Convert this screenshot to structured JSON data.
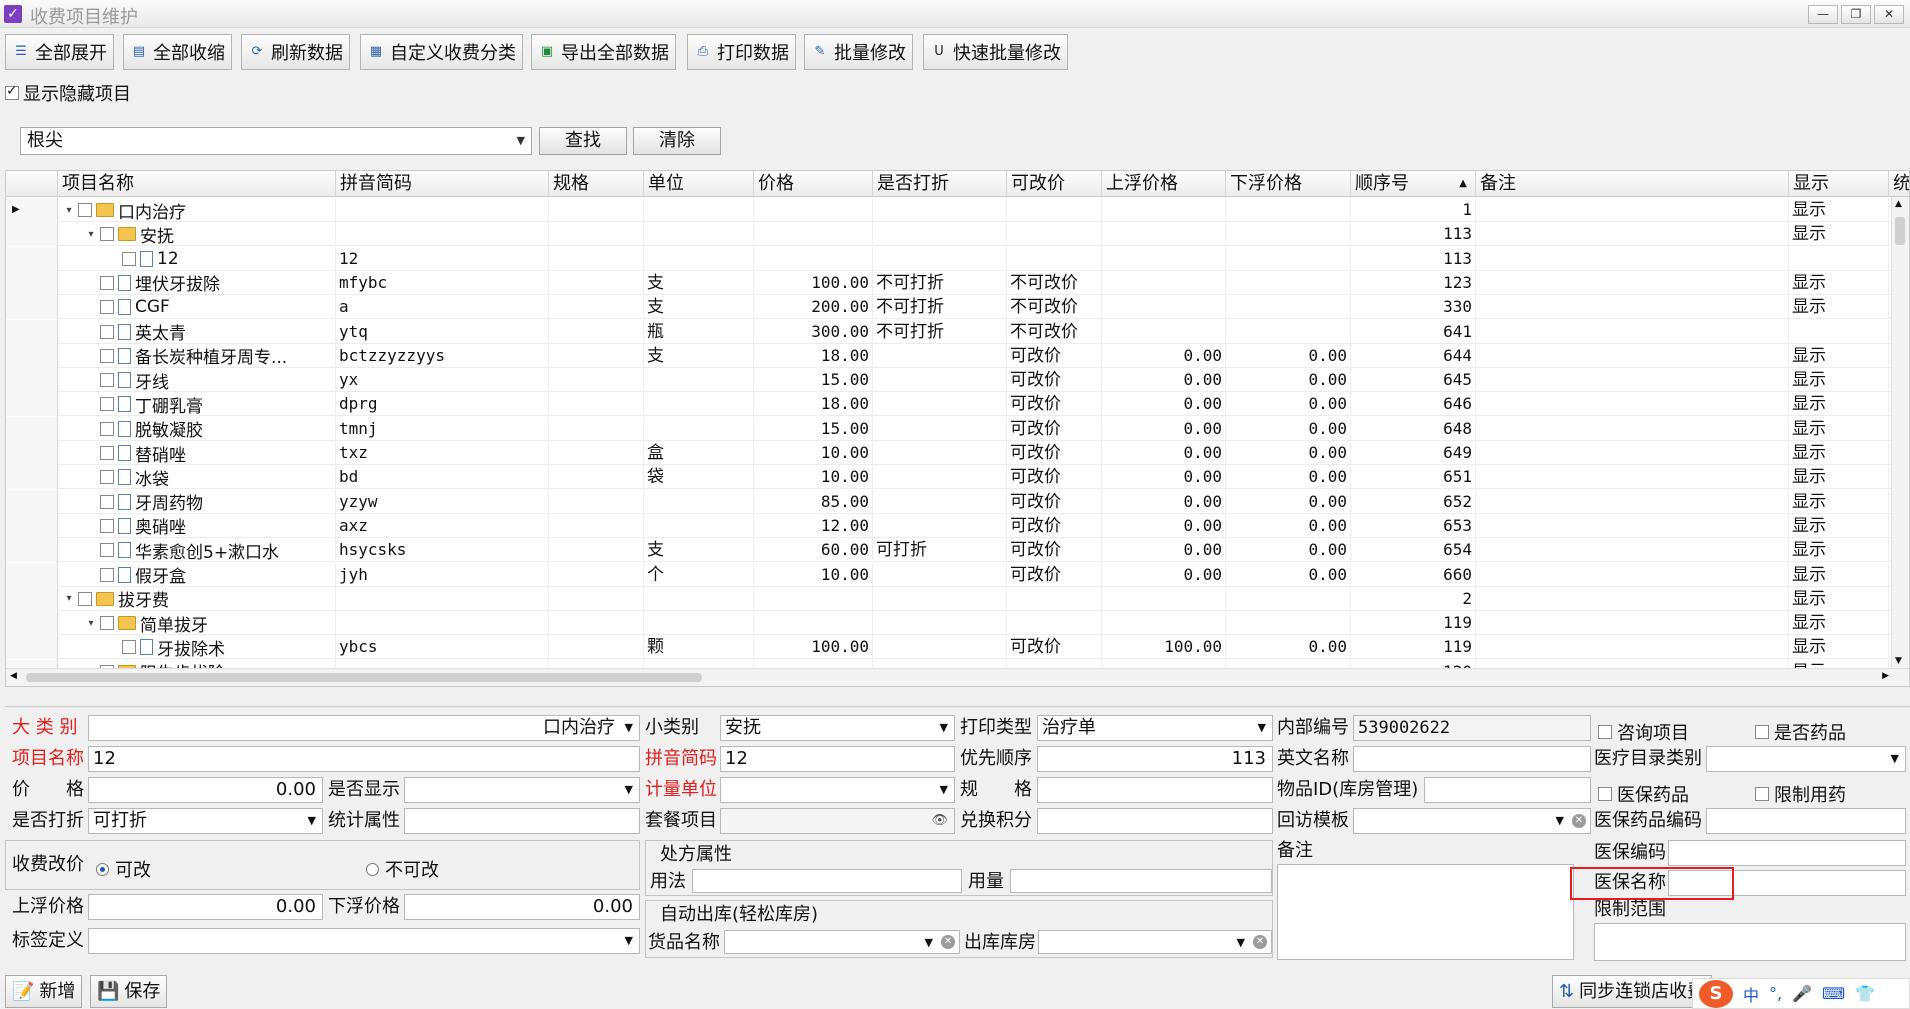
{
  "window": {
    "title": "收费项目维护",
    "controls": [
      "—",
      "❐",
      "✕"
    ]
  },
  "toolbar": {
    "expand_all": "全部展开",
    "collapse_all": "全部收缩",
    "refresh": "刷新数据",
    "custom_category": "自定义收费分类",
    "export_all": "导出全部数据",
    "print": "打印数据",
    "batch_edit": "批量修改",
    "quick_batch_edit": "快速批量修改"
  },
  "show_hidden": {
    "label": "显示隐藏项目",
    "checked": true
  },
  "search": {
    "value": "根尖",
    "find_label": "查找",
    "clear_label": "清除"
  },
  "grid": {
    "columns": [
      "项目名称",
      "拼音简码",
      "规格",
      "单位",
      "价格",
      "是否打折",
      "可改价",
      "上浮价格",
      "下浮价格",
      "顺序号",
      "备注",
      "显示",
      "统计"
    ],
    "sorted_column": "顺序号",
    "rows": [
      {
        "name": "口内治疗",
        "py": "",
        "unit": "",
        "price": "",
        "discount": "",
        "changeable": "",
        "up": "",
        "down": "",
        "order": "1",
        "show": "显示",
        "level": 0,
        "kind": "folder",
        "expanded": true,
        "current": true
      },
      {
        "name": "安抚",
        "py": "",
        "unit": "",
        "price": "",
        "discount": "",
        "changeable": "",
        "up": "",
        "down": "",
        "order": "113",
        "show": "显示",
        "level": 1,
        "kind": "folder",
        "expanded": true
      },
      {
        "name": "12",
        "py": "12",
        "unit": "",
        "price": "",
        "discount": "",
        "changeable": "",
        "up": "",
        "down": "",
        "order": "113",
        "show": "",
        "level": 2,
        "kind": "doc"
      },
      {
        "name": "埋伏牙拔除",
        "py": "mfybc",
        "unit": "支",
        "price": "100.00",
        "discount": "不可打折",
        "changeable": "不可改价",
        "up": "",
        "down": "",
        "order": "123",
        "show": "显示",
        "level": 1,
        "kind": "doc"
      },
      {
        "name": "CGF",
        "py": "a",
        "unit": "支",
        "price": "200.00",
        "discount": "不可打折",
        "changeable": "不可改价",
        "up": "",
        "down": "",
        "order": "330",
        "show": "显示",
        "level": 1,
        "kind": "doc"
      },
      {
        "name": "英太青",
        "py": "ytq",
        "unit": "瓶",
        "price": "300.00",
        "discount": "不可打折",
        "changeable": "不可改价",
        "up": "",
        "down": "",
        "order": "641",
        "show": "",
        "level": 1,
        "kind": "doc"
      },
      {
        "name": "备长炭种植牙周专...",
        "py": "bctzzyzzyys",
        "unit": "支",
        "price": "18.00",
        "discount": "",
        "changeable": "可改价",
        "up": "0.00",
        "down": "0.00",
        "order": "644",
        "show": "显示",
        "level": 1,
        "kind": "doc"
      },
      {
        "name": "牙线",
        "py": "yx",
        "unit": "",
        "price": "15.00",
        "discount": "",
        "changeable": "可改价",
        "up": "0.00",
        "down": "0.00",
        "order": "645",
        "show": "显示",
        "level": 1,
        "kind": "doc"
      },
      {
        "name": "丁硼乳膏",
        "py": "dprg",
        "unit": "",
        "price": "18.00",
        "discount": "",
        "changeable": "可改价",
        "up": "0.00",
        "down": "0.00",
        "order": "646",
        "show": "显示",
        "level": 1,
        "kind": "doc"
      },
      {
        "name": "脱敏凝胶",
        "py": "tmnj",
        "unit": "",
        "price": "15.00",
        "discount": "",
        "changeable": "可改价",
        "up": "0.00",
        "down": "0.00",
        "order": "648",
        "show": "显示",
        "level": 1,
        "kind": "doc"
      },
      {
        "name": "替硝唑",
        "py": "txz",
        "unit": "盒",
        "price": "10.00",
        "discount": "",
        "changeable": "可改价",
        "up": "0.00",
        "down": "0.00",
        "order": "649",
        "show": "显示",
        "level": 1,
        "kind": "doc"
      },
      {
        "name": "冰袋",
        "py": "bd",
        "unit": "袋",
        "price": "10.00",
        "discount": "",
        "changeable": "可改价",
        "up": "0.00",
        "down": "0.00",
        "order": "651",
        "show": "显示",
        "level": 1,
        "kind": "doc"
      },
      {
        "name": "牙周药物",
        "py": "yzyw",
        "unit": "",
        "price": "85.00",
        "discount": "",
        "changeable": "可改价",
        "up": "0.00",
        "down": "0.00",
        "order": "652",
        "show": "显示",
        "level": 1,
        "kind": "doc"
      },
      {
        "name": "奥硝唑",
        "py": "axz",
        "unit": "",
        "price": "12.00",
        "discount": "",
        "changeable": "可改价",
        "up": "0.00",
        "down": "0.00",
        "order": "653",
        "show": "显示",
        "level": 1,
        "kind": "doc"
      },
      {
        "name": "华素愈创5+漱口水",
        "py": "hsycsks",
        "unit": "支",
        "price": "60.00",
        "discount": "可打折",
        "changeable": "可改价",
        "up": "0.00",
        "down": "0.00",
        "order": "654",
        "show": "显示",
        "level": 1,
        "kind": "doc"
      },
      {
        "name": "假牙盒",
        "py": "jyh",
        "unit": "个",
        "price": "10.00",
        "discount": "",
        "changeable": "可改价",
        "up": "0.00",
        "down": "0.00",
        "order": "660",
        "show": "显示",
        "level": 1,
        "kind": "doc"
      },
      {
        "name": "拔牙费",
        "py": "",
        "unit": "",
        "price": "",
        "discount": "",
        "changeable": "",
        "up": "",
        "down": "",
        "order": "2",
        "show": "显示",
        "level": 0,
        "kind": "folder",
        "expanded": true
      },
      {
        "name": "简单拔牙",
        "py": "",
        "unit": "",
        "price": "",
        "discount": "",
        "changeable": "",
        "up": "",
        "down": "",
        "order": "119",
        "show": "显示",
        "level": 1,
        "kind": "folder",
        "expanded": true
      },
      {
        "name": "牙拔除术",
        "py": "ybcs",
        "unit": "颗",
        "price": "100.00",
        "discount": "",
        "changeable": "可改价",
        "up": "100.00",
        "down": "0.00",
        "order": "119",
        "show": "显示",
        "level": 2,
        "kind": "doc"
      },
      {
        "name": "阻生齿拔除",
        "py": "",
        "unit": "",
        "price": "",
        "discount": "",
        "changeable": "",
        "up": "",
        "down": "",
        "order": "120",
        "show": "显示",
        "level": 1,
        "kind": "folder",
        "expanded": true
      }
    ]
  },
  "form": {
    "major_category": {
      "label": "大 类 别",
      "value": "口内治疗"
    },
    "minor_category": {
      "label": "小类别",
      "value": "安抚"
    },
    "print_type": {
      "label": "打印类型",
      "value": "治疗单"
    },
    "internal_code": {
      "label": "内部编号",
      "value": "539002622"
    },
    "consult_item": {
      "label": "咨询项目",
      "checked": false
    },
    "is_drug": {
      "label": "是否药品",
      "checked": false
    },
    "item_name": {
      "label": "项目名称",
      "value": "12"
    },
    "pinyin": {
      "label": "拼音简码",
      "value": "12"
    },
    "priority": {
      "label": "优先顺序",
      "value": "113"
    },
    "english_name": {
      "label": "英文名称",
      "value": ""
    },
    "medical_catalog": {
      "label": "医疗目录类别",
      "value": ""
    },
    "price": {
      "label": "价　　格",
      "value": "0.00"
    },
    "is_shown": {
      "label": "是否显示",
      "value": ""
    },
    "unit": {
      "label": "计量单位",
      "value": ""
    },
    "spec": {
      "label": "规　　格",
      "value": ""
    },
    "goods_id": {
      "label": "物品ID(库房管理)",
      "value": ""
    },
    "insurance_drug": {
      "label": "医保药品",
      "checked": false
    },
    "restricted_drug": {
      "label": "限制用药",
      "checked": false
    },
    "discount": {
      "label": "是否打折",
      "value": "可打折"
    },
    "stat_attr": {
      "label": "统计属性",
      "value": ""
    },
    "package_item": {
      "label": "套餐项目",
      "value": ""
    },
    "points": {
      "label": "兑换积分",
      "value": ""
    },
    "followup_template": {
      "label": "回访模板",
      "value": ""
    },
    "insurance_drug_code": {
      "label": "医保药品编码",
      "value": ""
    },
    "price_change": {
      "label": "收费改价",
      "option_yes": "可改",
      "option_no": "不可改",
      "selected": "可改"
    },
    "prescription": {
      "title": "处方属性",
      "usage_label": "用法",
      "dosage_label": "用量"
    },
    "remarks": {
      "label": "备注",
      "value": ""
    },
    "insurance_code": {
      "label": "医保编码",
      "value": ""
    },
    "insurance_name": {
      "label": "医保名称",
      "value": ""
    },
    "restricted_range": {
      "label": "限制范围",
      "value": ""
    },
    "up_price": {
      "label": "上浮价格",
      "value": "0.00"
    },
    "down_price": {
      "label": "下浮价格",
      "value": "0.00"
    },
    "auto_outbound": {
      "title": "自动出库(轻松库房)",
      "goods_label": "货品名称",
      "warehouse_label": "出库库房"
    },
    "tag_def": {
      "label": "标签定义",
      "value": ""
    }
  },
  "bottom": {
    "add": "新增",
    "save": "保存",
    "sync": "同步连锁店收费",
    "ime_lang": "中"
  }
}
